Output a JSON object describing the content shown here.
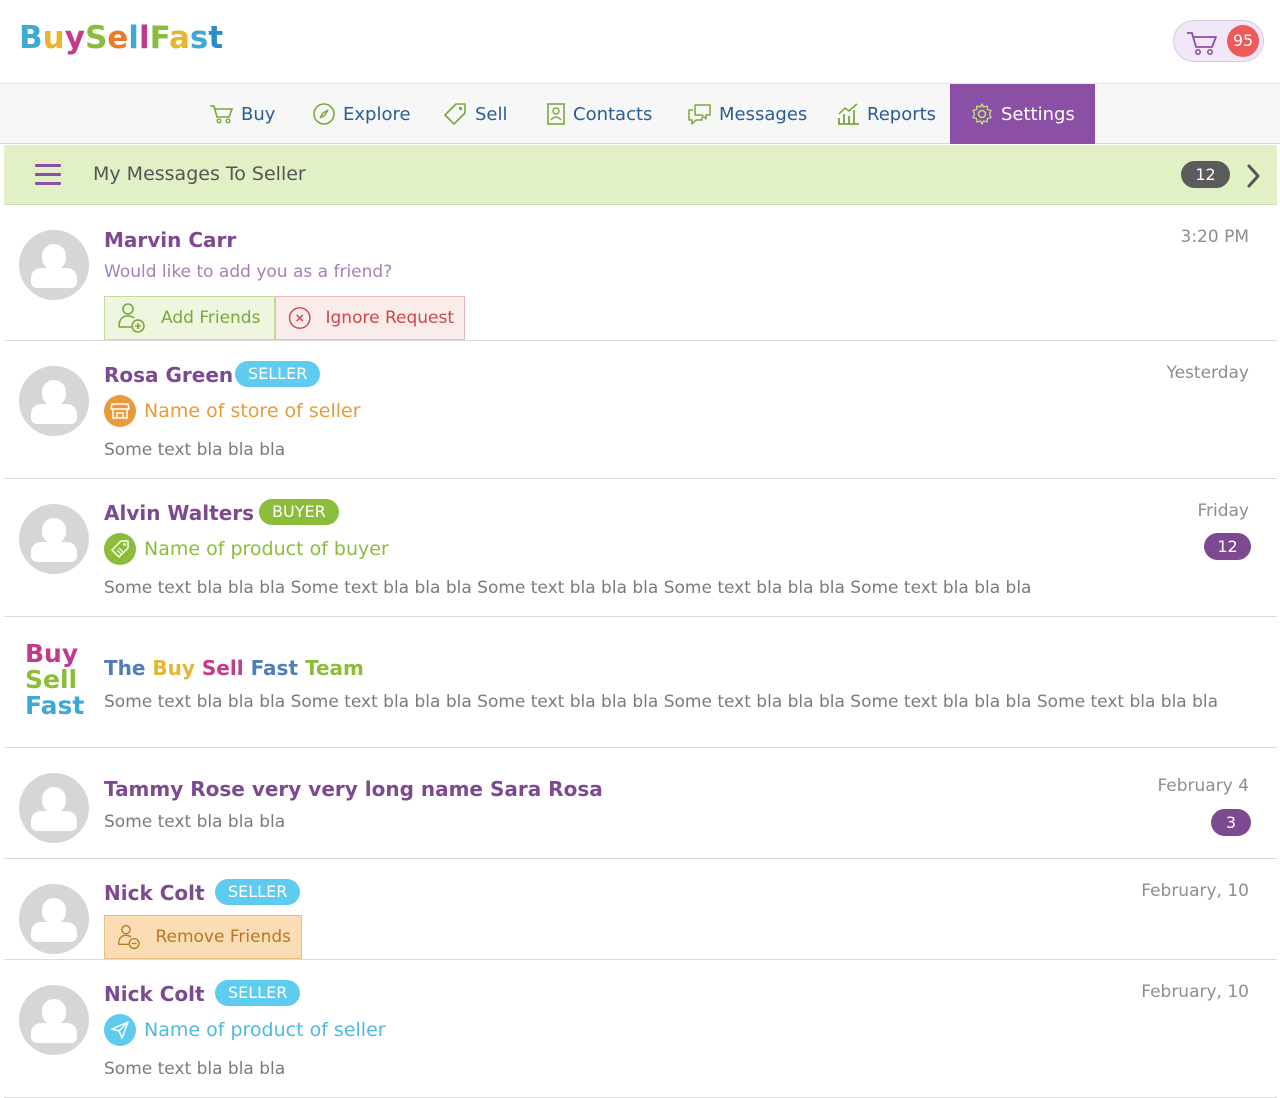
{
  "header": {
    "logo_parts": [
      {
        "text": "B",
        "color": "#3fa9d6"
      },
      {
        "text": "u",
        "color": "#e6b531"
      },
      {
        "text": "y",
        "color": "#c23a8a"
      },
      {
        "text": "S",
        "color": "#8bbd3a"
      },
      {
        "text": "e",
        "color": "#e97c2f"
      },
      {
        "text": "l",
        "color": "#3fa9d6"
      },
      {
        "text": "l",
        "color": "#c23a8a"
      },
      {
        "text": "F",
        "color": "#8bbd3a"
      },
      {
        "text": "a",
        "color": "#e6b531"
      },
      {
        "text": "s",
        "color": "#3fa9d6"
      },
      {
        "text": "t",
        "color": "#2a8ec6"
      }
    ],
    "cart_count": "95"
  },
  "nav": {
    "items": [
      {
        "label": "Buy",
        "icon": "cart-icon"
      },
      {
        "label": "Explore",
        "icon": "compass-icon"
      },
      {
        "label": "Sell",
        "icon": "tag-icon"
      },
      {
        "label": "Contacts",
        "icon": "contacts-icon"
      },
      {
        "label": "Messages",
        "icon": "chat-icon"
      },
      {
        "label": "Reports",
        "icon": "chart-icon"
      },
      {
        "label": "Settings",
        "icon": "gear-icon"
      }
    ]
  },
  "subbar": {
    "title": "My Messages To Seller",
    "count": "12"
  },
  "messages": [
    {
      "name": "Marvin Carr",
      "time": "3:20 PM",
      "text": "Would like to add you as a friend?",
      "actions": [
        "Add Friends",
        "Ignore Request"
      ]
    },
    {
      "name": "Rosa Green",
      "role": "SELLER",
      "time": "Yesterday",
      "link": "Name of store of seller",
      "text": "Some text bla bla bla"
    },
    {
      "name": "Alvin Walters",
      "role": "BUYER",
      "time": "Friday",
      "count": "12",
      "link": "Name of product of buyer",
      "text": "Some text bla bla bla Some text bla bla bla Some text bla bla bla Some text bla bla bla Some text bla bla bla"
    },
    {
      "team_logo": [
        "Buy",
        "Sell",
        "Fast"
      ],
      "team_name_parts": [
        "The ",
        "Buy ",
        "Sell ",
        "Fast ",
        "Team"
      ],
      "text": "Some text bla bla bla Some text bla bla bla Some text bla bla bla Some text bla bla bla Some text bla bla bla Some text bla bla bla"
    },
    {
      "name": "Tammy Rose very very long name Sara Rosa",
      "time": "February 4",
      "count": "3",
      "text": "Some text bla bla bla"
    },
    {
      "name": "Nick Colt",
      "role": "SELLER",
      "time": "February, 10",
      "actions": [
        "Remove Friends"
      ]
    },
    {
      "name": "Nick Colt",
      "role": "SELLER",
      "time": "February, 10",
      "link": "Name of product of seller",
      "text": "Some text bla bla bla"
    }
  ],
  "colors": {
    "brand_purple": "#7d4a92",
    "nav_active": "#8b4fa6",
    "subbar_bg": "#e2f0c5",
    "seller_badge": "#5fcbee",
    "buyer_badge": "#8bbd3a",
    "store_orange": "#e99a3a"
  }
}
